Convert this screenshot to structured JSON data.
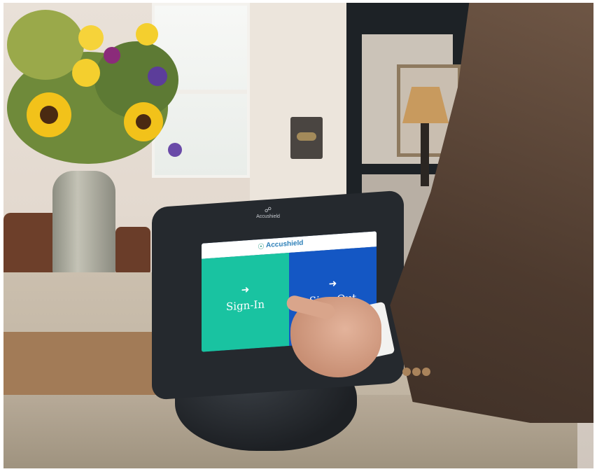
{
  "kiosk": {
    "brand": "Accushield",
    "brand_icon": "lock-icon",
    "screen": {
      "header_brand": "Accushield",
      "sign_in_label": "Sign-In",
      "sign_out_label": "Sign-Out",
      "sign_in_icon": "arrow-in-icon",
      "sign_out_icon": "arrow-out-icon"
    }
  },
  "colors": {
    "sign_in_tile": "#19c3a1",
    "sign_out_tile": "#1457c4",
    "kiosk_frame": "#25292e"
  }
}
